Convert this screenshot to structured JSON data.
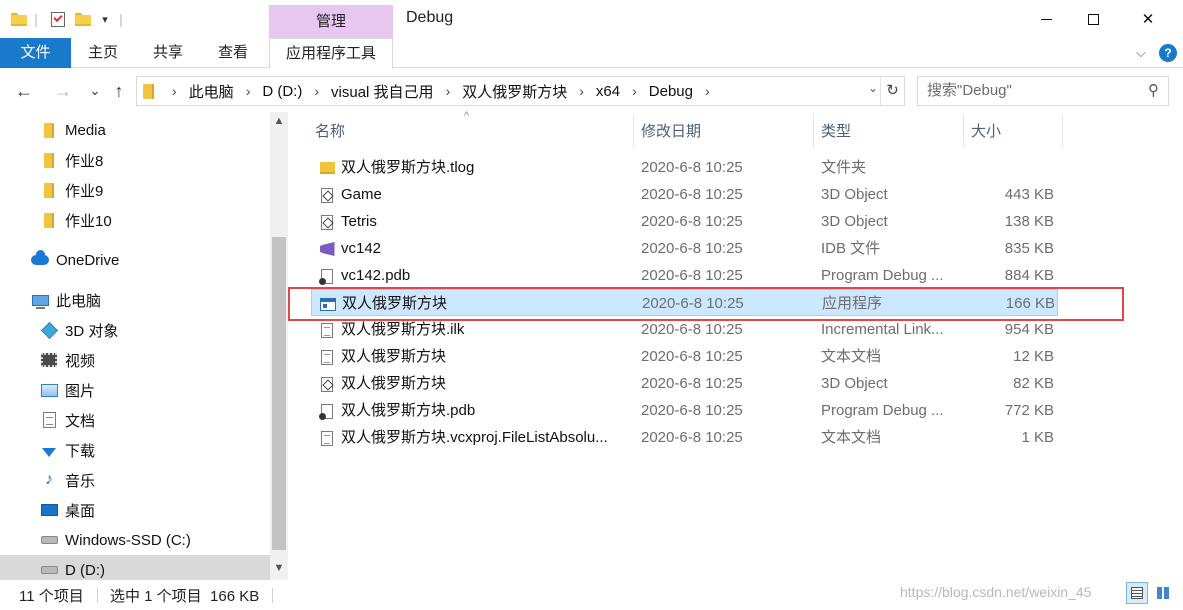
{
  "window": {
    "title": "Debug",
    "manage_tab": "管理",
    "controls": {
      "minimize": "—",
      "maximize": "☐",
      "close": "✕"
    }
  },
  "ribbon": {
    "tabs": [
      "文件",
      "主页",
      "共享",
      "查看",
      "应用程序工具"
    ],
    "collapse_icon": "⌵",
    "help_icon": "?"
  },
  "address": {
    "back": "←",
    "forward": "→",
    "recent": "⌄",
    "up": "↑",
    "crumbs": [
      "此电脑",
      "D (D:)",
      "visual 我自己用",
      "双人俄罗斯方块",
      "x64",
      "Debug"
    ],
    "search_placeholder": "搜索\"Debug\""
  },
  "nav": {
    "items": [
      {
        "label": "Media",
        "icon": "folder-icon"
      },
      {
        "label": "作业8",
        "icon": "folder-icon"
      },
      {
        "label": "作业9",
        "icon": "folder-icon"
      },
      {
        "label": "作业10",
        "icon": "folder-icon"
      },
      {
        "label": "OneDrive",
        "icon": "onedrive-icon"
      },
      {
        "label": "此电脑",
        "icon": "this-pc-icon"
      },
      {
        "label": "3D 对象",
        "icon": "3d-objects-icon"
      },
      {
        "label": "视频",
        "icon": "videos-icon"
      },
      {
        "label": "图片",
        "icon": "pictures-icon"
      },
      {
        "label": "文档",
        "icon": "documents-icon"
      },
      {
        "label": "下载",
        "icon": "downloads-icon"
      },
      {
        "label": "音乐",
        "icon": "music-icon"
      },
      {
        "label": "桌面",
        "icon": "desktop-icon"
      },
      {
        "label": "Windows-SSD (C:)",
        "icon": "drive-icon"
      },
      {
        "label": "D (D:)",
        "icon": "drive-icon"
      }
    ]
  },
  "columns": {
    "name": "名称",
    "date": "修改日期",
    "type": "类型",
    "size": "大小"
  },
  "files": [
    {
      "name": "双人俄罗斯方块.tlog",
      "date": "2020-6-8 10:25",
      "type": "文件夹",
      "size": "",
      "icon": "folder-icon"
    },
    {
      "name": "Game",
      "date": "2020-6-8 10:25",
      "type": "3D Object",
      "size": "443 KB",
      "icon": "3d-object-file-icon"
    },
    {
      "name": "Tetris",
      "date": "2020-6-8 10:25",
      "type": "3D Object",
      "size": "138 KB",
      "icon": "3d-object-file-icon"
    },
    {
      "name": "vc142",
      "date": "2020-6-8 10:25",
      "type": "IDB 文件",
      "size": "835 KB",
      "icon": "visual-studio-icon"
    },
    {
      "name": "vc142.pdb",
      "date": "2020-6-8 10:25",
      "type": "Program Debug ...",
      "size": "884 KB",
      "icon": "pdb-file-icon"
    },
    {
      "name": "双人俄罗斯方块",
      "date": "2020-6-8 10:25",
      "type": "应用程序",
      "size": "166 KB",
      "icon": "application-icon"
    },
    {
      "name": "双人俄罗斯方块.ilk",
      "date": "2020-6-8 10:25",
      "type": "Incremental Link...",
      "size": "954 KB",
      "icon": "ilk-file-icon"
    },
    {
      "name": "双人俄罗斯方块",
      "date": "2020-6-8 10:25",
      "type": "文本文档",
      "size": "12 KB",
      "icon": "text-file-icon"
    },
    {
      "name": "双人俄罗斯方块",
      "date": "2020-6-8 10:25",
      "type": "3D Object",
      "size": "82 KB",
      "icon": "3d-object-file-icon"
    },
    {
      "name": "双人俄罗斯方块.pdb",
      "date": "2020-6-8 10:25",
      "type": "Program Debug ...",
      "size": "772 KB",
      "icon": "pdb-file-icon"
    },
    {
      "name": "双人俄罗斯方块.vcxproj.FileListAbsolu...",
      "date": "2020-6-8 10:25",
      "type": "文本文档",
      "size": "1 KB",
      "icon": "text-file-icon"
    }
  ],
  "status": {
    "count": "11 个项目",
    "selection": "选中 1 个项目  166 KB",
    "watermark": "https://blog.csdn.net/weixin_45"
  },
  "colors": {
    "accent": "#1979ca",
    "manage": "#e7c7f0",
    "selection": "#cce8ff",
    "highlight_box": "#e0464b"
  }
}
